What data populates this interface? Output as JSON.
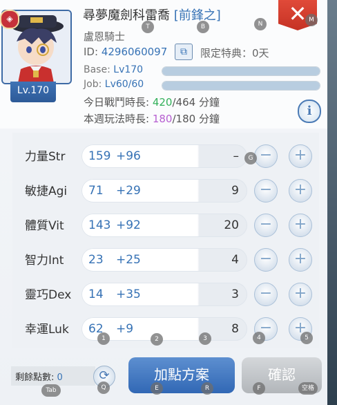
{
  "character": {
    "name": "尋夢魔劍科雷喬",
    "position": "[前鋒之]",
    "job": "盧恩騎士",
    "level_badge": "Lv.170",
    "id_label": "ID:",
    "id_value": "4296060097",
    "limited_label": "限定特典：",
    "limited_value": "0天",
    "base_label": "Base:",
    "base_value": "Lv170",
    "job_label": "Job:",
    "job_value": "Lv60/60",
    "today_label": "今日戰鬥時長:",
    "today_current": "420",
    "today_total": "/464",
    "week_label": "本週玩法時長:",
    "week_current": "180",
    "week_total": "/180",
    "minutes_unit": "分鐘"
  },
  "stats": [
    {
      "label": "力量Str",
      "base": "159",
      "bonus": "+96",
      "cost": "–"
    },
    {
      "label": "敏捷Agi",
      "base": "71",
      "bonus": "+29",
      "cost": "9"
    },
    {
      "label": "體質Vit",
      "base": "143",
      "bonus": "+92",
      "cost": "20"
    },
    {
      "label": "智力Int",
      "base": "23",
      "bonus": "+25",
      "cost": "4"
    },
    {
      "label": "靈巧Dex",
      "base": "14",
      "bonus": "+35",
      "cost": "3"
    },
    {
      "label": "幸運Luk",
      "base": "62",
      "bonus": "+9",
      "cost": "8"
    }
  ],
  "footer": {
    "remaining_label": "剩餘點數:",
    "remaining_value": "0",
    "plan_button": "加點方案",
    "confirm_button": "確認"
  },
  "hotkeys": {
    "T": "T",
    "B": "B",
    "N": "N",
    "M": "M",
    "G": "G",
    "h1": "1",
    "h2": "2",
    "h3": "3",
    "h4": "4",
    "h5": "5",
    "Tab": "Tab",
    "Q": "Q",
    "E": "E",
    "R": "R",
    "F": "F",
    "Space": "空格"
  },
  "icons": {
    "close": "close-icon",
    "info": "info-icon",
    "copy": "copy-icon",
    "refresh": "refresh-icon",
    "minus": "minus-icon",
    "plus": "plus-icon"
  },
  "bars": {
    "base_fill": 1.0,
    "job_fill": 1.0
  }
}
